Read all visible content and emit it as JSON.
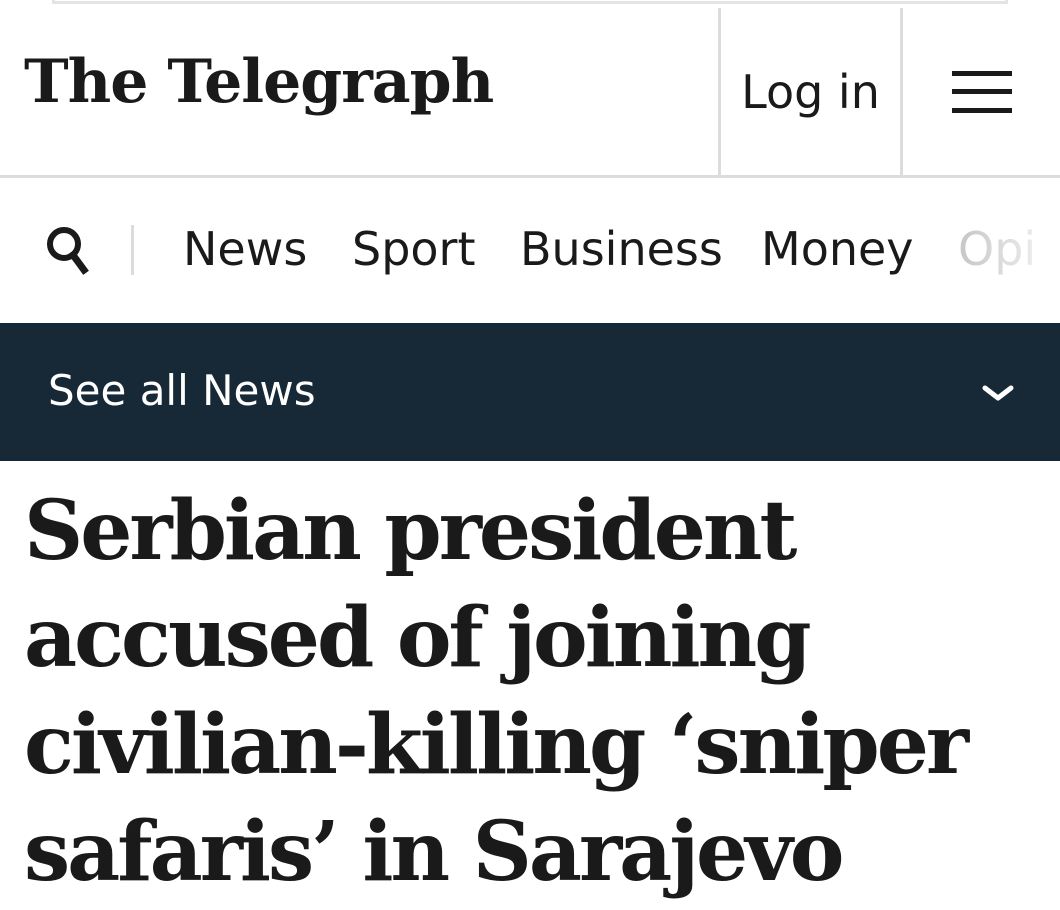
{
  "header": {
    "logo_text": "The Telegraph",
    "login_label": "Log in",
    "menu_icon": "hamburger-menu-icon"
  },
  "nav": {
    "search_icon": "search-icon",
    "items": [
      {
        "label": "News"
      },
      {
        "label": "Sport"
      },
      {
        "label": "Business"
      },
      {
        "label": "Money"
      },
      {
        "label": "Opi"
      }
    ]
  },
  "section_bar": {
    "label": "See all News",
    "icon": "chevron-down-icon",
    "background": "#172937"
  },
  "article": {
    "headline": "Serbian president accused of joining civilian-killing ‘sniper safaris’ in Sarajevo"
  }
}
